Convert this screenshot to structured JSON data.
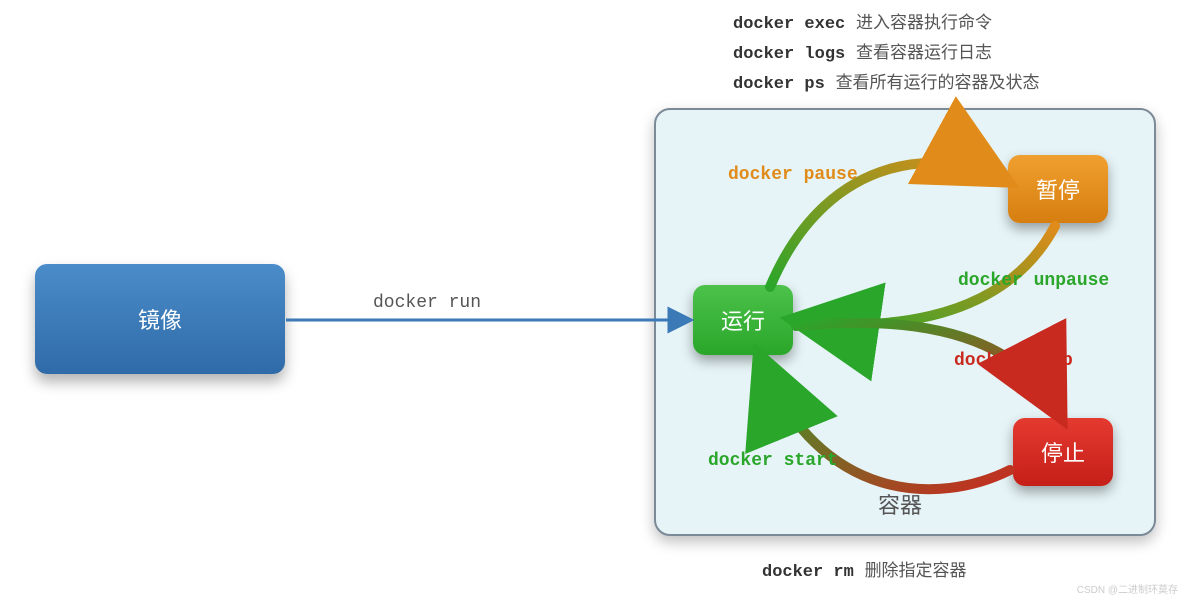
{
  "legend": [
    {
      "cmd": "docker exec",
      "desc": "进入容器执行命令"
    },
    {
      "cmd": "docker logs",
      "desc": "查看容器运行日志"
    },
    {
      "cmd": "docker ps",
      "desc": "查看所有运行的容器及状态"
    }
  ],
  "nodes": {
    "image": {
      "label": "镜像"
    },
    "running": {
      "label": "运行"
    },
    "paused": {
      "label": "暂停"
    },
    "stopped": {
      "label": "停止"
    }
  },
  "edges": {
    "run": {
      "label": "docker run"
    },
    "pause": {
      "label": "docker pause"
    },
    "unpause": {
      "label": "docker unpause"
    },
    "stop": {
      "label": "docker stop"
    },
    "start": {
      "label": "docker start"
    }
  },
  "container_title": "容器",
  "footer": {
    "cmd": "docker rm",
    "desc": "删除指定容器"
  },
  "watermark": "CSDN @二进制环莫存"
}
